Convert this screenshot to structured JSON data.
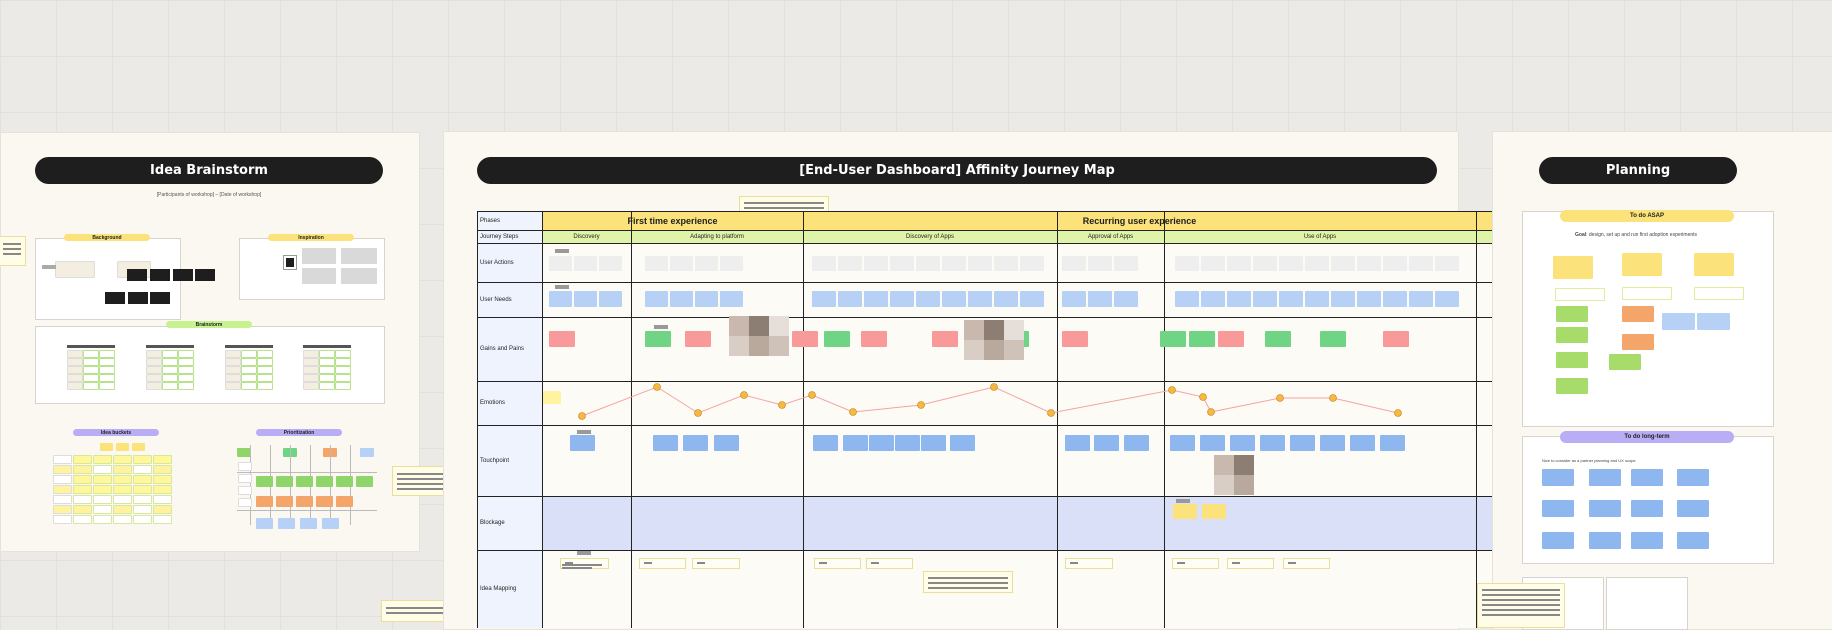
{
  "board": {
    "frames": {
      "brainstorm": {
        "title": "Idea Brainstorm",
        "subtitle": "[Participants of workshop] – [Date of workshop]",
        "sections": {
          "background": "Background",
          "inspiration": "Inspiration",
          "brainstorm": "Brainstorm",
          "idea_buckets": "Idea buckets",
          "prioritization": "Prioritization"
        }
      },
      "journey": {
        "title": "[End-User Dashboard] Affinity Journey Map",
        "phases_label": "Phases",
        "phases": [
          "First time experience",
          "Recurring user experience"
        ],
        "steps_label": "Journey Steps",
        "steps": [
          "Discovery",
          "Adapting to platform",
          "Discovery of Apps",
          "Approval of Apps",
          "Use of Apps"
        ],
        "rows": [
          "User Actions",
          "User Needs",
          "Gains and Pains",
          "Emotions",
          "Touchpoint",
          "Blockage",
          "Idea Mapping"
        ]
      },
      "planning": {
        "title": "Planning",
        "todo_asap": "To do ASAP",
        "goal_label": "Goal",
        "goal_text": ": design, set up and run first adoption experiments",
        "todo_long_term": "To do long-term",
        "long_term_caption": "Nice to consider as a partner planning and UX scope"
      }
    },
    "colors": {
      "canvas": "#eceae6",
      "frame": "#fbf8f1",
      "pill": "#1e1e1e",
      "yellow": "#fbe27a",
      "green_tag": "#c6f28f",
      "purple_tag": "#b9aef5",
      "blue_sticky": "#8fb7ef",
      "light_blue_sticky": "#b6d0f6",
      "red_sticky": "#f99a9a",
      "green_sticky": "#6fd585",
      "orange_sticky": "#f4a66a",
      "blockage_row": "#dbe0f9"
    }
  }
}
